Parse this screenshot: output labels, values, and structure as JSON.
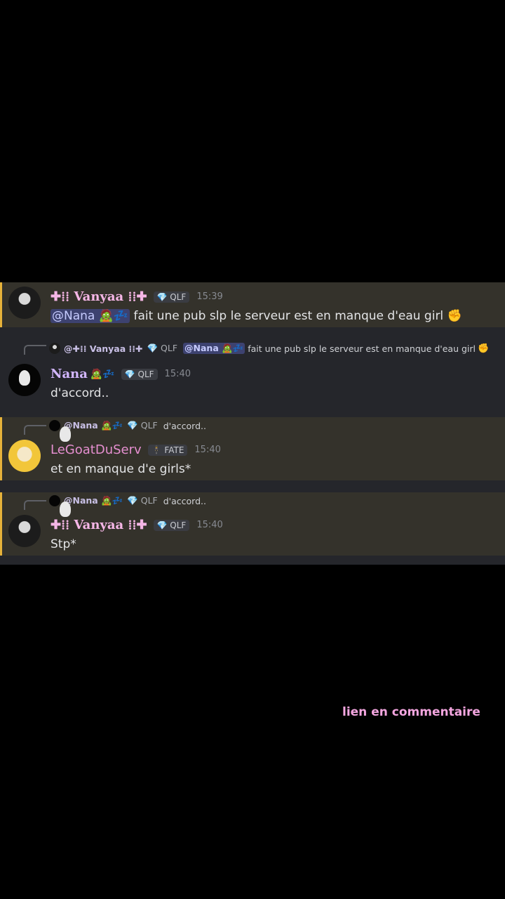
{
  "messages": [
    {
      "author": "✚⁞⁞ Vanyaa ⁞⁞✚",
      "role_tag": "💎 QLF",
      "time": "15:39",
      "mention": "@Nana 🧟💤",
      "text": "fait une pub slp le serveur est en manque d'eau girl",
      "emoji": "✊"
    },
    {
      "reply": {
        "name": "@✚⁞⁞ Vanyaa ⁞⁞✚",
        "tag": "💎 QLF",
        "mention": "@Nana 🧟💤",
        "text": "fait une pub slp le serveur est en manque d'eau girl",
        "emoji": "✊"
      },
      "author": "Nana",
      "author_emoji": "🧟💤",
      "role_tag": "💎 QLF",
      "time": "15:40",
      "text": "d'accord.."
    },
    {
      "reply": {
        "name": "@Nana 🧟💤",
        "tag": "💎 QLF",
        "text": "d'accord.."
      },
      "author": "LeGoatDuServ",
      "role_tag": "🕴 FATE",
      "time": "15:40",
      "text": "et en manque d'e girls*"
    },
    {
      "reply": {
        "name": "@Nana 🧟💤",
        "tag": "💎 QLF",
        "text": "d'accord.."
      },
      "author": "✚⁞⁞ Vanyaa ⁞⁞✚",
      "role_tag": "💎 QLF",
      "time": "15:40",
      "text": "Stp*"
    }
  ],
  "overlay_text": "lien en commentaire",
  "colors": {
    "highlight_bar": "#e6b23a",
    "mention_bg": "#3d4270",
    "overlay": "#f4a6e0"
  }
}
